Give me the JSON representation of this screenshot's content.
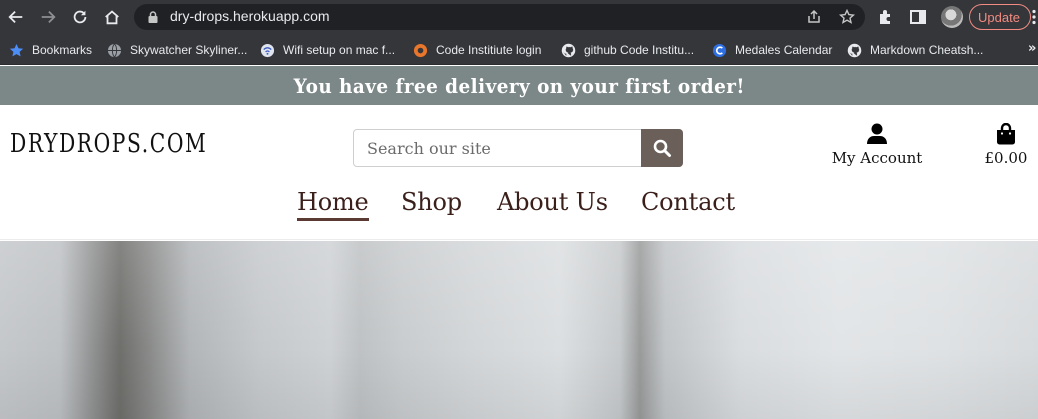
{
  "browser": {
    "url": "dry-drops.herokuapp.com",
    "update_label": "Update",
    "bookmarks": [
      {
        "label": "Bookmarks",
        "icon": "star-icon"
      },
      {
        "label": "Skywatcher Skyliner...",
        "icon": "globe-icon"
      },
      {
        "label": "Wifi setup on mac f...",
        "icon": "wifi-site-icon"
      },
      {
        "label": "Code Institiute login",
        "icon": "code-institute-icon"
      },
      {
        "label": "github Code Institu...",
        "icon": "github-icon"
      },
      {
        "label": "Medales Calendar",
        "icon": "calendar-site-icon"
      },
      {
        "label": "Markdown Cheatsh...",
        "icon": "github-icon"
      }
    ],
    "more_bookmarks": "»"
  },
  "site": {
    "promo_text": "You have free delivery on your first order!",
    "logo": "DRYDROPS.COM",
    "search_placeholder": "Search our site",
    "account_label": "My Account",
    "cart_total": "£0.00",
    "nav": [
      {
        "label": "Home",
        "active": true
      },
      {
        "label": "Shop",
        "active": false
      },
      {
        "label": "About Us",
        "active": false
      },
      {
        "label": "Contact",
        "active": false
      }
    ]
  },
  "colors": {
    "chrome_bg": "#35363a",
    "omnibox_bg": "#202124",
    "promo_bg": "#7c8788",
    "search_button": "#6b5f5a",
    "nav_text": "#3a1f1a",
    "update_accent": "#f28b82"
  }
}
